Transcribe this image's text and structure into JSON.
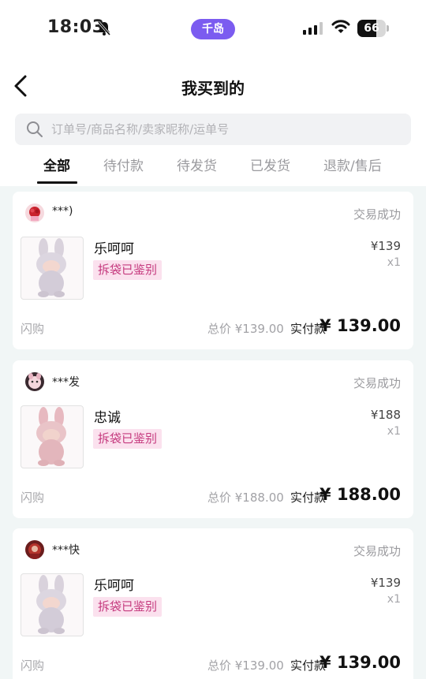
{
  "status_bar": {
    "time": "18:03",
    "app_pill": "千岛",
    "battery": "66",
    "battery_level": 0.66
  },
  "header": {
    "title": "我买到的"
  },
  "search": {
    "placeholder": "订单号/商品名称/卖家昵称/运单号"
  },
  "tabs": [
    "全部",
    "待付款",
    "待发货",
    "已发货",
    "退款/售后"
  ],
  "orders": [
    {
      "seller": "***)",
      "status": "交易成功",
      "product": "乐呵呵",
      "tag": "拆袋已鉴别",
      "price": "¥139",
      "qty": "x1",
      "channel": "闪购",
      "total": "总价 ¥139.00",
      "paid_label": "实付款",
      "paid": "¥ 139.00"
    },
    {
      "seller": "***发",
      "status": "交易成功",
      "product": "忠诚",
      "tag": "拆袋已鉴别",
      "price": "¥188",
      "qty": "x1",
      "channel": "闪购",
      "total": "总价 ¥188.00",
      "paid_label": "实付款",
      "paid": "¥ 188.00"
    },
    {
      "seller": "***快",
      "status": "交易成功",
      "product": "乐呵呵",
      "tag": "拆袋已鉴别",
      "price": "¥139",
      "qty": "x1",
      "channel": "闪购",
      "total": "总价 ¥139.00",
      "paid_label": "实付款",
      "paid": "¥ 139.00"
    }
  ],
  "colors": {
    "accent_pill": "#7b5cf0",
    "tag_bg": "#fbe1ee",
    "tag_text": "#c53a7e",
    "page_bg": "#f1f6f6"
  }
}
